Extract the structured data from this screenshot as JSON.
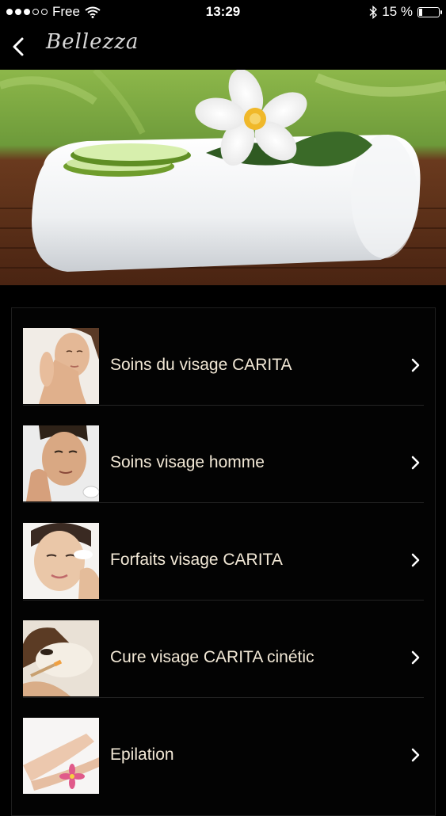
{
  "status_bar": {
    "carrier": "Free",
    "time": "13:29",
    "battery_text": "15 %",
    "battery_level": 0.15
  },
  "nav": {
    "logo_text": "Bellezza"
  },
  "list": {
    "items": [
      {
        "label": "Soins du visage CARITA"
      },
      {
        "label": "Soins visage homme"
      },
      {
        "label": "Forfaits visage CARITA"
      },
      {
        "label": "Cure visage CARITA cinétic"
      },
      {
        "label": "Epilation"
      }
    ]
  },
  "icons": {
    "back": "chevron-left-icon",
    "row_arrow": "chevron-right-icon",
    "wifi": "wifi-icon",
    "bluetooth": "bluetooth-icon",
    "battery": "battery-icon"
  },
  "colors": {
    "background": "#000000",
    "label": "#f2e8d6"
  }
}
